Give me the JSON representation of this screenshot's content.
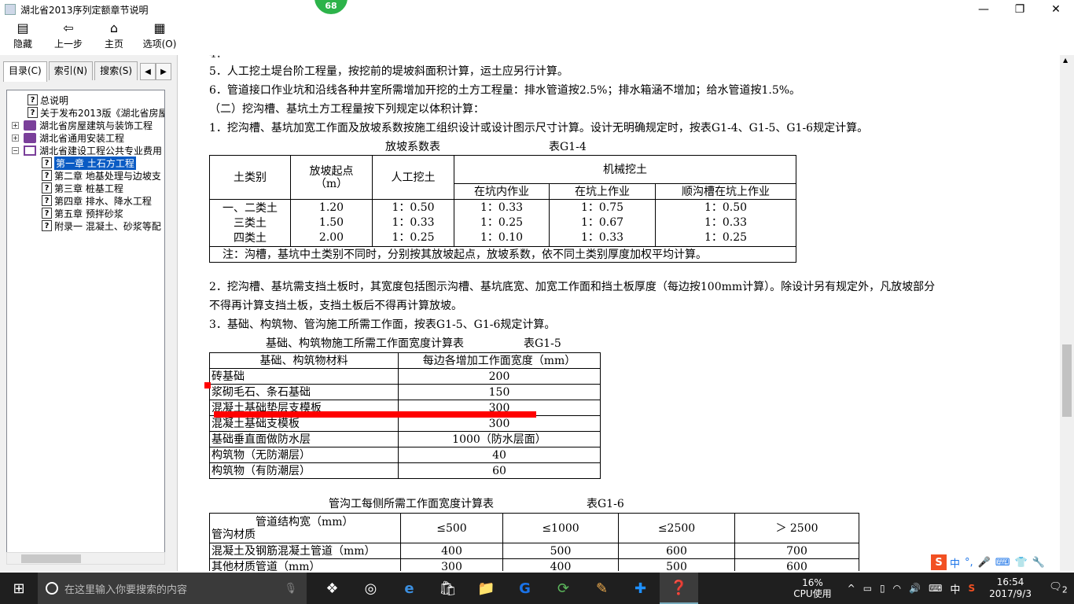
{
  "window": {
    "title": "湖北省2013序列定额章节说明",
    "badge": "68",
    "controls": [
      "—",
      "❐",
      "✕"
    ]
  },
  "toolbar": {
    "buttons": [
      {
        "label": "隐藏",
        "icon": "hide-icon"
      },
      {
        "label": "上一步",
        "icon": "back-arrow-icon"
      },
      {
        "label": "主页",
        "icon": "home-icon"
      },
      {
        "label": "选项(O)",
        "icon": "options-icon"
      }
    ]
  },
  "nav": {
    "tabs": [
      "目录(C)",
      "索引(N)",
      "搜索(S)"
    ],
    "tree": [
      {
        "label": "总说明",
        "type": "page",
        "level": 2
      },
      {
        "label": "关于发布2013版《湖北省房屋",
        "type": "page",
        "level": 2
      },
      {
        "label": "湖北省房屋建筑与装饰工程",
        "type": "book",
        "level": 1
      },
      {
        "label": "湖北省通用安装工程",
        "type": "book",
        "level": 1
      },
      {
        "label": "湖北省建设工程公共专业费用",
        "type": "openbook",
        "level": 1
      },
      {
        "label": "第一章 土石方工程",
        "type": "page",
        "level": 3,
        "selected": true
      },
      {
        "label": "第二章 地基处理与边坡支",
        "type": "page",
        "level": 3
      },
      {
        "label": "第三章 桩基工程",
        "type": "page",
        "level": 3
      },
      {
        "label": "第四章 排水、降水工程",
        "type": "page",
        "level": 3
      },
      {
        "label": "第五章 预拌砂浆",
        "type": "page",
        "level": 3
      },
      {
        "label": "附录一 混凝土、砂浆等配",
        "type": "page",
        "level": 3
      }
    ]
  },
  "doc": {
    "line5": "5．人工挖土堤台阶工程量，按挖前的堤坡斜面积计算，运土应另行计算。",
    "line6": "6．管道接口作业坑和沿线各种井室所需增加开挖的土方工程量：排水管道按2.5%；排水箱涵不增加；给水管道按1.5%。",
    "sec2": "（二）挖沟槽、基坑土方工程量按下列规定以体积计算：",
    "item1": "1．挖沟槽、基坑加宽工作面及放坡系数按施工组织设计或设计图示尺寸计算。设计无明确规定时，按表G1-4、G1-5、G1-6规定计算。",
    "t4caption": "放坡系数表",
    "t4id": "表G1-4",
    "t4": {
      "h_soil": "土类别",
      "h_start1": "放坡起点",
      "h_start2": "（m）",
      "h_manual": "人工挖土",
      "h_mech": "机械挖土",
      "h_sub": [
        "在坑内作业",
        "在坑上作业",
        "顺沟槽在坑上作业"
      ],
      "rows": [
        [
          "一、二类土",
          "1.20",
          "1：0.50",
          "1：0.33",
          "1：0.75",
          "1：0.50"
        ],
        [
          "三类土",
          "1.50",
          "1：0.33",
          "1：0.25",
          "1：0.67",
          "1：0.33"
        ],
        [
          "四类土",
          "2.00",
          "1：0.25",
          "1：0.10",
          "1：0.33",
          "1：0.25"
        ]
      ],
      "note": "注：沟槽，基坑中土类别不同时，分别按其放坡起点，放坡系数，依不同土类别厚度加权平均计算。"
    },
    "item2a": "2．挖沟槽、基坑需支挡土板时，其宽度包括图示沟槽、基坑底宽、加宽工作面和挡土板厚度（每边按100mm计算）。除设计另有规定外，凡放坡部分",
    "item2b": "不得再计算支挡土板，支挡土板后不得再计算放坡。",
    "item3": "3．基础、构筑物、管沟施工所需工作面，按表G1-5、G1-6规定计算。",
    "t5caption": "基础、构筑物施工所需工作面宽度计算表",
    "t5id": "表G1-5",
    "t5": {
      "h_mat": "基础、构筑物材料",
      "h_width": "每边各增加工作面宽度（mm）",
      "rows": [
        [
          "砖基础",
          "200"
        ],
        [
          "浆砌毛石、条石基础",
          "150"
        ],
        [
          "混凝土基础垫层支模板",
          "300"
        ],
        [
          "混凝土基础支模板",
          "300"
        ],
        [
          "基础垂直面做防水层",
          "1000（防水层面）"
        ],
        [
          "构筑物（无防潮层）",
          "40"
        ],
        [
          "构筑物（有防潮层）",
          "60"
        ]
      ]
    },
    "t6caption": "管沟工每侧所需工作面宽度计算表",
    "t6id": "表G1-6",
    "t6": {
      "h_a": "管道结构宽（mm）",
      "h_b": "管沟材质",
      "cols": [
        "≤500",
        "≤1000",
        "≤2500",
        "＞ 2500"
      ],
      "rows": [
        [
          "混凝土及钢筋混凝土管道（mm）",
          "400",
          "500",
          "600",
          "700"
        ],
        [
          "其他材质管道（mm）",
          "300",
          "400",
          "500",
          "600"
        ]
      ]
    }
  },
  "taskbar": {
    "search_placeholder": "在这里输入你要搜索的内容",
    "cpu_pct": "16%",
    "cpu_label": "CPU使用",
    "ime": "中",
    "time": "16:54",
    "date": "2017/9/3",
    "notif": "2"
  },
  "imebar": {
    "label": "中"
  }
}
